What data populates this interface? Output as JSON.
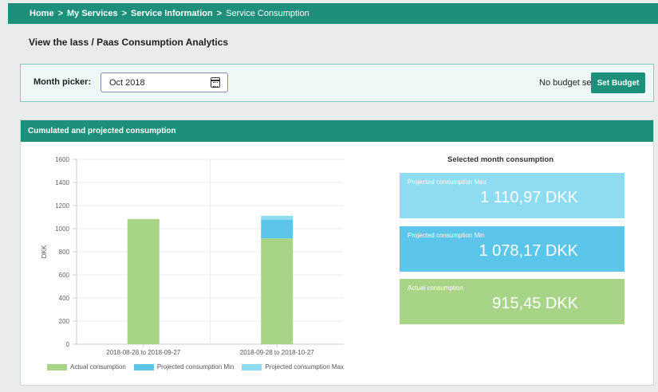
{
  "breadcrumb": {
    "items": [
      "Home",
      "My Services",
      "Service Information",
      "Service Consumption"
    ],
    "separator": ">"
  },
  "page": {
    "title": "View the Iass / Paas Consumption Analytics"
  },
  "month_picker": {
    "label": "Month picker:",
    "value": "Oct 2018",
    "icon": "calendar-icon"
  },
  "budget": {
    "status": "No budget set",
    "button_label": "Set Budget"
  },
  "consumption_panel": {
    "title": "Cumulated and projected consumption"
  },
  "selected_month": {
    "title": "Selected month consumption",
    "cards": [
      {
        "label": "Projected consumption Max",
        "value": "1 110,97 DKK",
        "color": "#8ddcf2"
      },
      {
        "label": "Projected consumption Min",
        "value": "1 078,17 DKK",
        "color": "#5bc5ea"
      },
      {
        "label": "Actual consumption",
        "value": "915,45 DKK",
        "color": "#a8d488"
      }
    ]
  },
  "colors": {
    "brand": "#1e8f7a",
    "actual": "#a8d488",
    "projected_min": "#5bc5ea",
    "projected_max": "#8ddcf2"
  },
  "chart_data": {
    "type": "bar",
    "stacked": true,
    "categories": [
      "2018-08-28 to 2018-09-27",
      "2018-09-28 to 2018-10-27"
    ],
    "series": [
      {
        "name": "Actual consumption",
        "values": [
          1083,
          915.45
        ],
        "color": "#a8d488"
      },
      {
        "name": "Projected consumption Min",
        "values": [
          0,
          162.72
        ],
        "color": "#5bc5ea"
      },
      {
        "name": "Projected consumption Max",
        "values": [
          0,
          32.8
        ],
        "color": "#8ddcf2"
      }
    ],
    "ylabel": "DKK",
    "ylim": [
      0,
      1600
    ],
    "yticks": [
      0,
      200,
      400,
      600,
      800,
      1000,
      1200,
      1400,
      1600
    ],
    "grid": true,
    "legend_position": "bottom"
  }
}
